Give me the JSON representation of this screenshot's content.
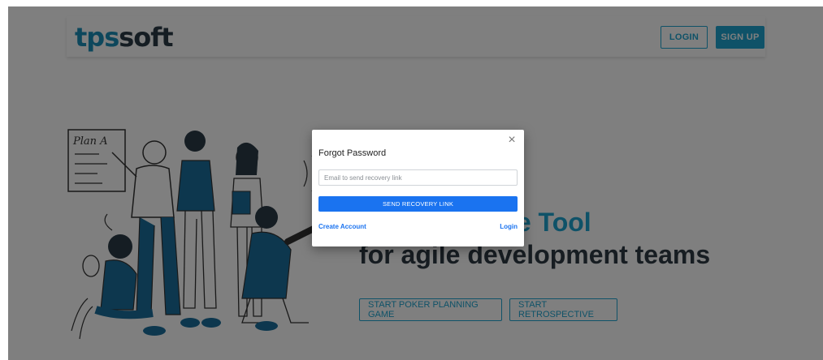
{
  "header": {
    "logo_part1": "tps",
    "logo_part2": "soft",
    "login_label": "LOGIN",
    "signup_label": "SIGN UP"
  },
  "illustration": {
    "whiteboard_text": "Plan A"
  },
  "hero": {
    "line1": "Retrospective Tool",
    "line2": "for agile development teams",
    "cta_poker": "START POKER PLANNING GAME",
    "cta_retro": "START RETROSPECTIVE"
  },
  "modal": {
    "title": "Forgot Password",
    "email_placeholder": "Email to send recovery link",
    "email_value": "",
    "send_label": "SEND RECOVERY LINK",
    "create_account_label": "Create Account",
    "login_label": "Login",
    "close_glyph": "×"
  },
  "colors": {
    "brand": "#1fa5d0",
    "primary_button": "#1a73f0",
    "dark_text": "#2f3b44"
  }
}
